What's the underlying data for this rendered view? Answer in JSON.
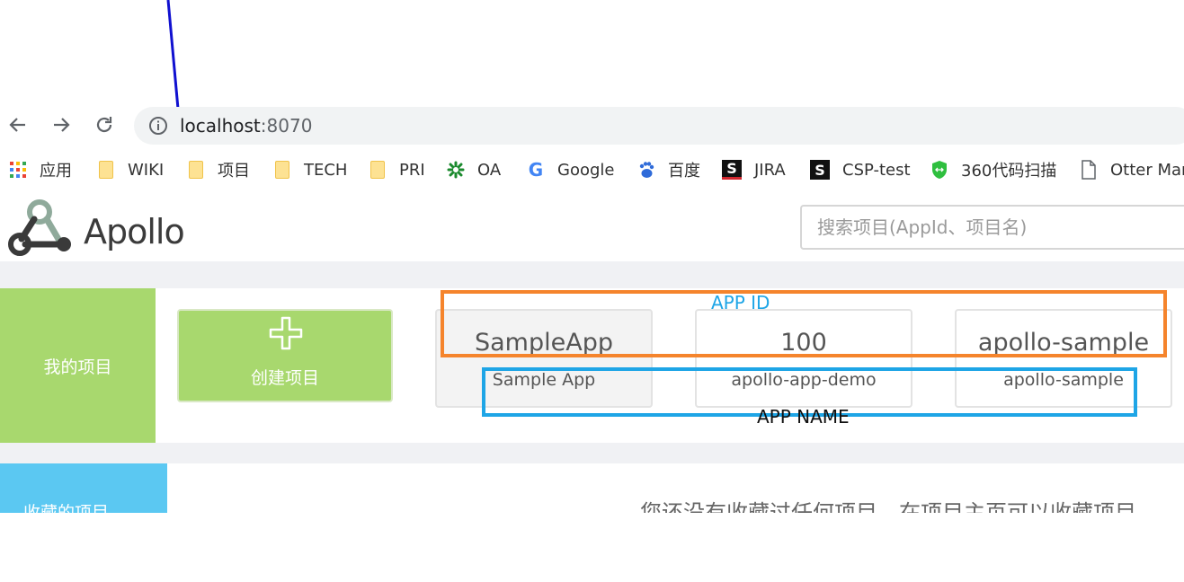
{
  "browser": {
    "url_host": "localhost",
    "url_port": ":8070"
  },
  "bookmarks": [
    {
      "label": "应用",
      "icon": "apps-grid-icon"
    },
    {
      "label": "WIKI",
      "icon": "folder-icon"
    },
    {
      "label": "项目",
      "icon": "folder-icon"
    },
    {
      "label": "TECH",
      "icon": "folder-icon"
    },
    {
      "label": "PRI",
      "icon": "folder-icon"
    },
    {
      "label": "OA",
      "icon": "oa-logo-icon"
    },
    {
      "label": "Google",
      "icon": "google-logo-icon"
    },
    {
      "label": "百度",
      "icon": "baidu-paw-icon"
    },
    {
      "label": "JIRA",
      "icon": "jira-s-icon"
    },
    {
      "label": "CSP-test",
      "icon": "csp-s-icon"
    },
    {
      "label": "360代码扫描",
      "icon": "shield-icon"
    },
    {
      "label": "Otter Mar",
      "icon": "document-icon"
    }
  ],
  "header": {
    "logo_text": "Apollo",
    "search_placeholder": "搜索项目(AppId、项目名)"
  },
  "my_projects": {
    "title": "我的项目",
    "create_label": "创建项目",
    "apps": [
      {
        "id": "SampleApp",
        "name": "Sample App"
      },
      {
        "id": "100",
        "name": "apollo-app-demo"
      },
      {
        "id": "apollo-sample",
        "name": "apollo-sample"
      }
    ]
  },
  "annotations": {
    "app_id_label": "APP ID",
    "app_name_label": "APP NAME"
  },
  "favorites": {
    "title": "收藏的项目",
    "empty_text": "您还没有收藏过任何项目，在项目主页可以收藏项目"
  },
  "colors": {
    "accent_green": "#a8d86e",
    "accent_blue": "#5bc8f2",
    "annotation_orange": "#f5842c",
    "annotation_blue": "#1ea5e6"
  }
}
